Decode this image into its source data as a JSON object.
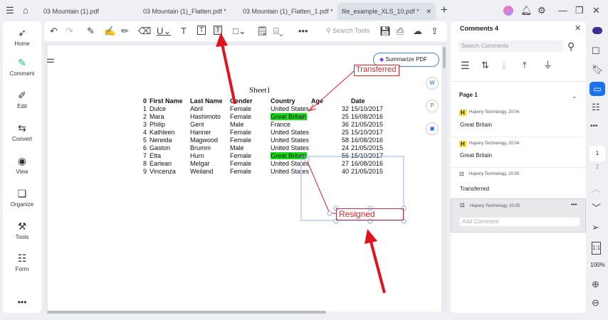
{
  "tabs": [
    "03 Mountain (1).pdf",
    "03 Mountain (1)_Flatten.pdf *",
    "03 Mountain (1)_Flatten_1.pdf *",
    "file_example_XLS_10.pdf *"
  ],
  "sidebar": [
    "Home",
    "Comment",
    "Edit",
    "Convert",
    "View",
    "Organize",
    "Tools",
    "Form"
  ],
  "toolbar": {
    "search_placeholder": "Search Tools"
  },
  "summarize": "Summarize PDF",
  "sheet": {
    "title": "Sheet1",
    "headers": [
      "0",
      "First Name",
      "Last Name",
      "Gender",
      "Country",
      "Age",
      "Date"
    ],
    "rows": [
      [
        "1",
        "Dulce",
        "Abril",
        "Female",
        "United States",
        "32",
        "15/10/2017"
      ],
      [
        "2",
        "Mara",
        "Hashimoto",
        "Female",
        "Great Britain",
        "25",
        "16/08/2016"
      ],
      [
        "3",
        "Philip",
        "Gent",
        "Male",
        "France",
        "36",
        "21/05/2015"
      ],
      [
        "4",
        "Kathleen",
        "Hanner",
        "Female",
        "United States",
        "25",
        "15/10/2017"
      ],
      [
        "5",
        "Nereida",
        "Magwood",
        "Female",
        "United States",
        "58",
        "16/08/2016"
      ],
      [
        "6",
        "Gaston",
        "Brumm",
        "Male",
        "United States",
        "24",
        "21/05/2015"
      ],
      [
        "7",
        "Etta",
        "Hurn",
        "Female",
        "Great Britain",
        "56",
        "15/10/2017"
      ],
      [
        "8",
        "Earlean",
        "Melgar",
        "Female",
        "United States",
        "27",
        "16/08/2016"
      ],
      [
        "9",
        "Vincenza",
        "Weiland",
        "Female",
        "United States",
        "40",
        "21/05/2015"
      ]
    ]
  },
  "callouts": {
    "transferred": "Transferred",
    "resigned": "Resigned"
  },
  "comments": {
    "title": "Comments 4",
    "search_placeholder": "Search Comments",
    "page": "Page 1",
    "add_placeholder": "Add Comment",
    "items": [
      {
        "author": "Hajvery Technology,  20:04",
        "text": "Great Britain",
        "type": "H"
      },
      {
        "author": "Hajvery Technology,  20:04",
        "text": "Great Britain",
        "type": "H"
      },
      {
        "author": "Hajvery Technology,  20:05",
        "text": "Transferred",
        "type": "callout"
      },
      {
        "author": "Hajvery Technology,  20:25",
        "text": "",
        "type": "callout"
      }
    ]
  },
  "pages": [
    "1",
    "2"
  ],
  "zoom": "100%"
}
